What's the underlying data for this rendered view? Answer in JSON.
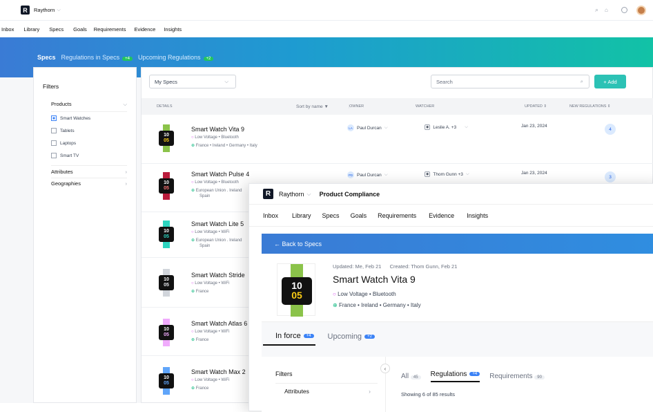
{
  "back": {
    "app_name": "Raythorn",
    "nav": [
      "Inbox",
      "Library",
      "Specs",
      "Goals",
      "Requirements",
      "Evidence",
      "Insights"
    ],
    "tabs": [
      {
        "label": "Specs"
      },
      {
        "label": "Regulations in Specs",
        "badge": "+4"
      },
      {
        "label": "Upcoming Regulations",
        "badge": "+2"
      }
    ],
    "filters": {
      "title": "Filters",
      "products_label": "Products",
      "products": [
        "Smart Watches",
        "Tablets",
        "Laptops",
        "Smart TV"
      ],
      "attributes_label": "Attributes",
      "geographies_label": "Geographies"
    },
    "list": {
      "view_select": "My Specs",
      "search_placeholder": "Search",
      "add_label": "+ Add",
      "columns": [
        "DETAILS",
        "Sort by name",
        "OWNER",
        "WATCHER",
        "UPDATED",
        "NEW REGULATIONS"
      ],
      "rows": [
        {
          "name": "Smart Watch Vita 9",
          "attrs": "Low Voltage • Bluetooth",
          "geo": "France • Ireland • Germany • Italy",
          "geo2": "",
          "owner_initials": "LA",
          "owner": "Paul Durcan",
          "watcher": "Leslie A. +3",
          "updated": "Jan 23, 2024",
          "new_regs": "4",
          "band": "#8bc34a"
        },
        {
          "name": "Smart Watch Pulse 4",
          "attrs": "Low Voltage • Bluetooth",
          "geo": "European Union . Ireland",
          "geo2": "Spain",
          "owner_initials": "PD",
          "owner": "Paul Durcan",
          "watcher": "Thom Gunn +3",
          "updated": "Jan 23, 2024",
          "new_regs": "3",
          "band": "#b91c3c"
        },
        {
          "name": "Smart Watch Lite 5",
          "attrs": "Low Voltage • WiFi",
          "geo": "European Union . Ireland",
          "geo2": "Spain",
          "band": "#2dd4bf"
        },
        {
          "name": "Smart Watch Stride",
          "attrs": "Low Voltage • WiFi",
          "geo": "France",
          "geo2": "",
          "band": "#d1d5db"
        },
        {
          "name": "Smart Watch Atlas 6",
          "attrs": "Low Voltage • WiFi",
          "geo": "France",
          "geo2": "",
          "band": "#f0abfc"
        },
        {
          "name": "Smart Watch Max 2",
          "attrs": "Low Voltage • WiFi",
          "geo": "France",
          "geo2": "",
          "band": "#60a5fa"
        }
      ]
    }
  },
  "front": {
    "app_name": "Raythorn",
    "page": "Product Compliance",
    "nav": [
      "Inbox",
      "Library",
      "Specs",
      "Goals",
      "Requirements",
      "Evidence",
      "Insights"
    ],
    "back_link": "← Back to Specs",
    "updated": "Updated: Me, Feb 21",
    "created": "Created: Thom Gunn, Feb 21",
    "title": "Smart Watch Vita 9",
    "attrs": "Low Voltage • Bluetooth",
    "geo": "France • Ireland • Germany • Italy",
    "watch_face": [
      "10",
      "05"
    ],
    "tabs": [
      {
        "label": "In force",
        "badge": "+4"
      },
      {
        "label": "Upcoming",
        "badge": "+2"
      }
    ],
    "filters_title": "Filters",
    "attributes_label": "Attributes",
    "subtabs": [
      {
        "label": "All",
        "count": "45"
      },
      {
        "label": "Regulations",
        "badge": "+4"
      },
      {
        "label": "Requirements",
        "count": "90"
      }
    ],
    "results": "Showing 6 of 85 results"
  },
  "colors": {
    "accent": "#3b82f6",
    "teal": "#12c2a6",
    "add_button": "#2cc2b5"
  }
}
